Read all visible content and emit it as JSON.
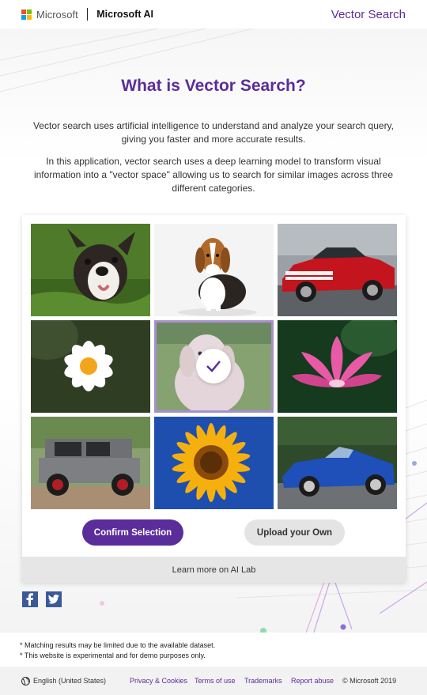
{
  "header": {
    "brand": "Microsoft",
    "product": "Microsoft AI",
    "app_title": "Vector Search"
  },
  "intro": {
    "title": "What is Vector Search?",
    "paragraph1": "Vector search uses artificial intelligence to understand and analyze your search query, giving you faster and more accurate results.",
    "paragraph2": "In this application, vector search uses a deep learning model to transform visual information into a \"vector space\" allowing us to search for similar images across three different categories."
  },
  "grid": {
    "images": [
      {
        "subject": "boston-terrier",
        "selected": false
      },
      {
        "subject": "beagle",
        "selected": false
      },
      {
        "subject": "red-mustang",
        "selected": false
      },
      {
        "subject": "white-daisy",
        "selected": false
      },
      {
        "subject": "golden-retriever",
        "selected": true
      },
      {
        "subject": "pink-lotus",
        "selected": false
      },
      {
        "subject": "g-wagon",
        "selected": false
      },
      {
        "subject": "sunflower",
        "selected": false
      },
      {
        "subject": "blue-convertible",
        "selected": false
      }
    ]
  },
  "actions": {
    "confirm_label": "Confirm Selection",
    "upload_label": "Upload your Own",
    "learn_more_label": "Learn more on AI Lab"
  },
  "notes": [
    "* Matching results may be limited due to the available dataset.",
    "* This website is experimental and for demo purposes only."
  ],
  "footer": {
    "locale": "English (United States)",
    "links": [
      "Privacy & Cookies",
      "Terms of use",
      "Trademarks",
      "Report abuse"
    ],
    "copyright": "© Microsoft 2019"
  },
  "colors": {
    "accent": "#5b2d9a",
    "selected_border": "#a78fd0",
    "logo": [
      "#f25022",
      "#7fba00",
      "#00a4ef",
      "#ffb900"
    ]
  },
  "icons": [
    "microsoft-logo-icon",
    "checkmark-icon",
    "facebook-icon",
    "twitter-icon",
    "globe-icon"
  ]
}
